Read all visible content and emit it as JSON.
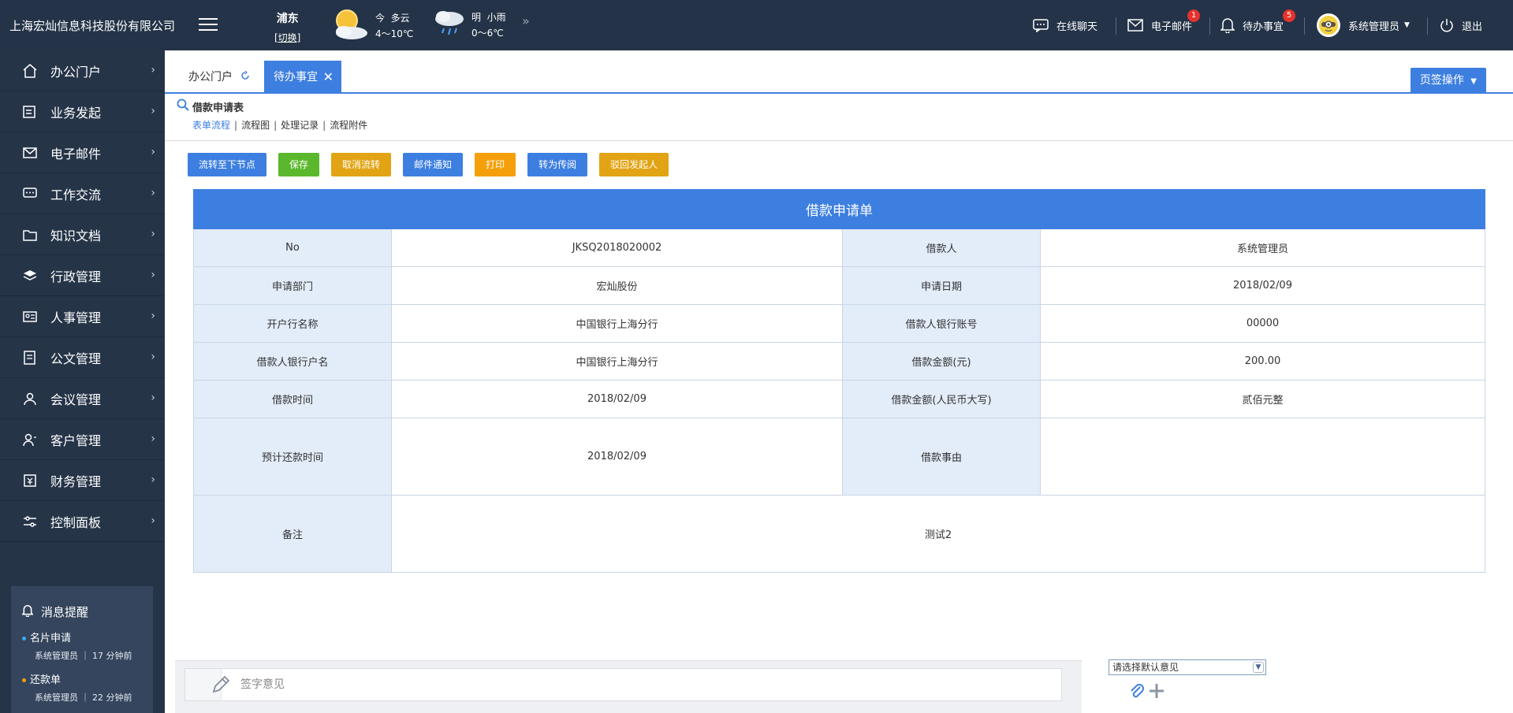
{
  "topbar": {
    "brand": "上海宏灿信息科技股份有限公司",
    "location": {
      "city": "浦东",
      "switch": "[切换]"
    },
    "weather": [
      {
        "day": "今",
        "cond": "多云",
        "temp": "4～10℃",
        "icon": "partly-cloudy-icon"
      },
      {
        "day": "明",
        "cond": "小雨",
        "temp": "0～6℃",
        "icon": "light-rain-icon"
      }
    ],
    "nav": {
      "chat": "在线聊天",
      "mail": "电子邮件",
      "mail_badge": "1",
      "todo": "待办事宜",
      "todo_badge": "5",
      "user": "系统管理员",
      "exit": "退出"
    }
  },
  "sidebar": {
    "items": [
      {
        "label": "办公门户",
        "icon": "home-icon"
      },
      {
        "label": "业务发起",
        "icon": "edit-doc-icon"
      },
      {
        "label": "电子邮件",
        "icon": "mail-icon"
      },
      {
        "label": "工作交流",
        "icon": "chat-icon"
      },
      {
        "label": "知识文档",
        "icon": "folder-icon"
      },
      {
        "label": "行政管理",
        "icon": "layers-icon"
      },
      {
        "label": "人事管理",
        "icon": "id-card-icon"
      },
      {
        "label": "公文管理",
        "icon": "document-icon"
      },
      {
        "label": "会议管理",
        "icon": "meeting-icon"
      },
      {
        "label": "客户管理",
        "icon": "customer-icon"
      },
      {
        "label": "财务管理",
        "icon": "finance-icon"
      },
      {
        "label": "控制面板",
        "icon": "sliders-icon"
      }
    ],
    "messages": {
      "title": "消息提醒",
      "items": [
        {
          "title": "名片申请",
          "meta": "系统管理员 ｜ 17 分钟前",
          "dot": "#3da9f5"
        },
        {
          "title": "还款单",
          "meta": "系统管理员 ｜ 22 分钟前",
          "dot": "#f5a00a"
        }
      ]
    }
  },
  "tabs": {
    "home": "办公门户",
    "todo": "待办事宜",
    "page_ops": "页签操作"
  },
  "form": {
    "title": "借款申请表",
    "subtabs": [
      "表单流程",
      "流程图",
      "处理记录",
      "流程附件"
    ],
    "buttons": [
      "流转至下节点",
      "保存",
      "取消流转",
      "邮件通知",
      "打印",
      "转为传阅",
      "驳回发起人"
    ],
    "table_title": "借款申请单",
    "rows": [
      {
        "l1": "No",
        "v1": "JKSQ2018020002",
        "l2": "借款人",
        "v2": "系统管理员"
      },
      {
        "l1": "申请部门",
        "v1": "宏灿股份",
        "l2": "申请日期",
        "v2": "2018/02/09"
      },
      {
        "l1": "开户行名称",
        "v1": "中国银行上海分行",
        "l2": "借款人银行账号",
        "v2": "00000"
      },
      {
        "l1": "借款人银行户名",
        "v1": "中国银行上海分行",
        "l2": "借款金额(元)",
        "v2": "200.00"
      },
      {
        "l1": "借款时间",
        "v1": "2018/02/09",
        "l2": "借款金额(人民币大写)",
        "v2": "贰佰元整"
      },
      {
        "l1": "预计还款时间",
        "v1": "2018/02/09",
        "l2": "借款事由",
        "v2": ""
      }
    ],
    "remark_label": "备注",
    "remark_value": "测试2"
  },
  "opinion": {
    "placeholder": "签字意见",
    "select_value": "请选择默认意见"
  },
  "colors": {
    "topbar": "#243347",
    "sidebar": "#263448",
    "accent": "#3d7fe0"
  }
}
